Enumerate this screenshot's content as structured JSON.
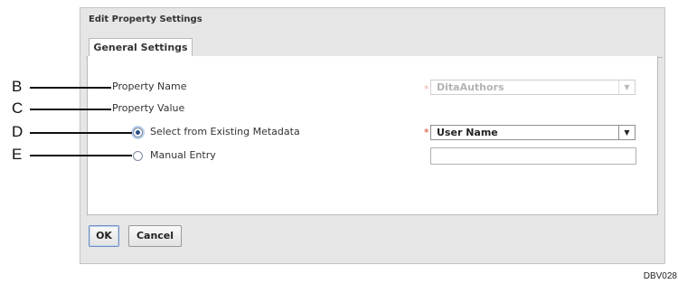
{
  "dialog": {
    "title": "Edit Property Settings",
    "tab": "General Settings",
    "property_name_label": "Property Name",
    "property_name_value": "DitaAuthors",
    "property_value_label": "Property Value",
    "option_existing_label": "Select from Existing Metadata",
    "option_manual_label": "Manual Entry",
    "selected_option": "Select from Existing Metadata",
    "metadata_select_value": "User Name",
    "required_mark": "*",
    "dropdown_arrow": "▼",
    "ok_label": "OK",
    "cancel_label": "Cancel"
  },
  "callouts": [
    "B",
    "C",
    "D",
    "E"
  ],
  "figure_id": "DBV028",
  "colors": {
    "required": "#d23a2a",
    "radio_selected": "#2a4f86",
    "dialog_bg": "#e6e6e6"
  }
}
